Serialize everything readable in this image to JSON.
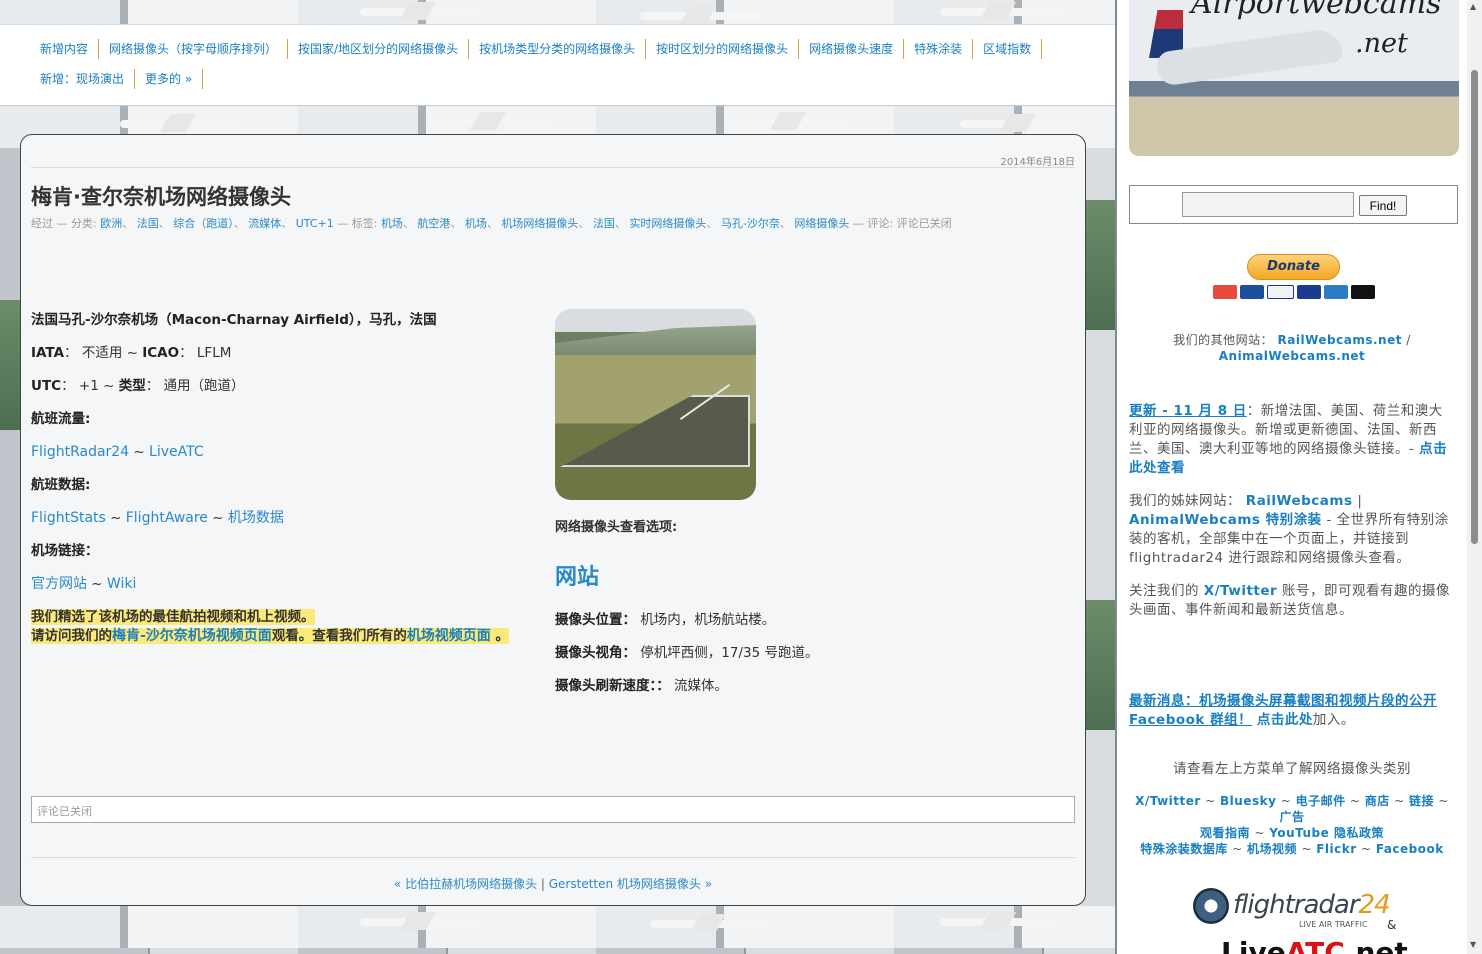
{
  "topnav": {
    "items": [
      "新增内容",
      "网络摄像头（按字母顺序排列）",
      "按国家/地区划分的网络摄像头",
      "按机场类型分类的网络摄像头",
      "按时区划分的网络摄像头",
      "网络摄像头速度",
      "特殊涂装",
      "区域指数",
      "新增：现场演出",
      "更多的 »"
    ]
  },
  "post": {
    "date": "2014年6月18日",
    "title": "梅肯·查尔奈机场网络摄像头",
    "meta": {
      "by": "经过 — 分类:",
      "categories": [
        "欧洲",
        "法国",
        "综合（跑道）",
        "流媒体",
        "UTC+1"
      ],
      "tags_label": "— 标签:",
      "tags": [
        "机场",
        "航空港",
        "机场",
        "机场网络摄像头",
        "法国",
        "实时网络摄像头",
        "马孔-沙尔奈",
        "网络摄像头"
      ],
      "comments_label": "— 评论:",
      "comments": "评论已关闭"
    },
    "left": {
      "location": "法国马孔-沙尔奈机场（Macon-Charnay Airfield），马孔，法国",
      "iata_label": "IATA",
      "iata_value": "不适用",
      "icao_label": "ICAO",
      "icao_value": "LFLM",
      "utc_label": "UTC",
      "utc_value": "+1",
      "type_label": "类型",
      "type_value": "通用（跑道）",
      "traffic_label": "航班流量:",
      "traffic_links": [
        "FlightRadar24",
        "LiveATC"
      ],
      "data_label": "航班数据:",
      "data_links": [
        "FlightStats",
        "FlightAware",
        "机场数据"
      ],
      "airport_links_label": "机场链接：",
      "airport_links": [
        "官方网站",
        "Wiki"
      ],
      "highlight_line1": "我们精选了该机场的最佳航拍视频和机上视频。",
      "highlight_line2_pre": "请访问我们的",
      "highlight_link1": "梅肯-沙尔奈机场视频页面",
      "highlight_line2_mid": "观看。查看我们所有的",
      "highlight_link2": "机场视频页面",
      "highlight_line2_end": " 。"
    },
    "right": {
      "view_options_label": "网络摄像头查看选项:",
      "site_link": "网站",
      "camera_position_label": "摄像头位置：",
      "camera_position_value": "机场内，机场航站楼。",
      "camera_view_label": "摄像头视角：",
      "camera_view_value": "停机坪西侧，17/35 号跑道。",
      "refresh_label": "摄像头刷新速度：：",
      "refresh_value": "流媒体。"
    },
    "comment_box": "评论已关闭",
    "prev_post": "« 比伯拉赫机场网络摄像头",
    "next_post": "Gerstetten 机场网络摄像头 »"
  },
  "sidebar": {
    "logo_text_1": "Airportwebcams",
    "logo_text_2": ".net",
    "search_button": "Find!",
    "donate_label": "Donate",
    "other_sites_label": "我们的其他网站：",
    "other_site_1": "RailWebcams.net",
    "other_site_sep": "/",
    "other_site_2": "AnimalWebcams.net",
    "update_link": "更新 - 11 月 8 日",
    "update_text": "：新增法国、美国、荷兰和澳大利亚的网络摄像头。新增或更新德国、法国、新西兰、美国、澳大利亚等地的网络摄像头链接。-",
    "update_more": "点击此处查看",
    "sister_label": "我们的姊妹网站：",
    "sister_1": "RailWebcams",
    "sister_sep": "|",
    "sister_2": "AnimalWebcams 特别涂装",
    "sister_text": "- 全世界所有特别涂装的客机，全部集中在一个页面上，并链接到 flightradar24 进行跟踪和网络摄像头查看。",
    "follow_pre": "关注我们的",
    "follow_link": "X/Twitter",
    "follow_text": "账号，即可观看有趣的摄像头画面、事件新闻和最新送货信息。",
    "news_link": "最新消息：机场摄像头屏幕截图和视频片段的公开 Facebook 群组！",
    "news_click": "点击此处",
    "news_end": "加入。",
    "menu_hint": "请查看左上方菜单了解网络摄像头类别",
    "footer_line1": [
      "X/Twitter",
      "Bluesky",
      "电子邮件",
      "商店",
      "链接",
      "广告"
    ],
    "footer_line2": [
      "观看指南",
      "YouTube 隐私政策"
    ],
    "footer_line3": [
      "特殊涂装数据库",
      "机场视频",
      "Flickr",
      "Facebook"
    ],
    "fr24_name_a": "flightradar",
    "fr24_name_b": "24",
    "fr24_sub": "LIVE AIR TRAFFIC",
    "amp": "&",
    "liveatc_a": "Live",
    "liveatc_b": "ATC",
    "liveatc_c": ".net"
  }
}
